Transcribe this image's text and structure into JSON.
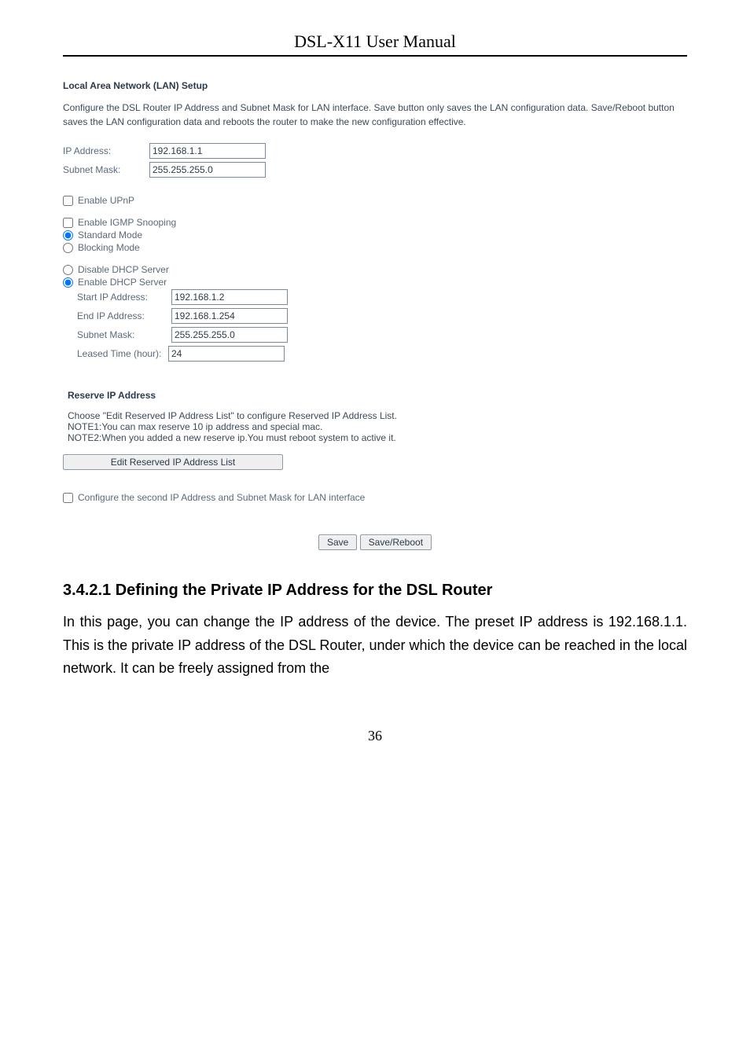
{
  "doc": {
    "header_title": "DSL-X11 User Manual",
    "page_number": "36"
  },
  "setup": {
    "title": "Local Area Network (LAN) Setup",
    "description": "Configure the DSL Router IP Address and Subnet Mask for LAN interface.  Save button only saves the LAN configuration data. Save/Reboot button saves the LAN configuration data and reboots the router to make the new configuration effective.",
    "ip_label": "IP Address:",
    "ip_value": "192.168.1.1",
    "mask_label": "Subnet Mask:",
    "mask_value": "255.255.255.0",
    "upnp_label": "Enable UPnP",
    "igmp_label": "Enable IGMP Snooping",
    "standard_label": "Standard Mode",
    "blocking_label": "Blocking Mode",
    "disable_dhcp_label": "Disable DHCP Server",
    "enable_dhcp_label": "Enable DHCP Server",
    "start_ip_label": "Start IP Address:",
    "start_ip_value": "192.168.1.2",
    "end_ip_label": "End IP Address:",
    "end_ip_value": "192.168.1.254",
    "dhcp_mask_label": "Subnet Mask:",
    "dhcp_mask_value": "255.255.255.0",
    "leased_label": "Leased Time (hour):",
    "leased_value": "24"
  },
  "reserve": {
    "title": "Reserve IP Address",
    "line1": "Choose \"Edit Reserved IP Address List\" to configure Reserved IP Address List.",
    "line2": "NOTE1:You can max reserve 10 ip address and special mac.",
    "line3": "NOTE2:When you added a new reserve ip.You must reboot system to active it.",
    "edit_btn": "Edit Reserved IP Address List"
  },
  "second_ip": {
    "label": "Configure the second IP Address and Subnet Mask for LAN interface"
  },
  "buttons": {
    "save": "Save",
    "save_reboot": "Save/Reboot"
  },
  "section": {
    "heading": "3.4.2.1  Defining the Private IP Address for the DSL Router",
    "paragraph": "In this page, you can change the IP address of the device. The preset IP address is 192.168.1.1. This is the private IP address of the DSL Router, under which the device can be reached in the local network. It can be freely assigned from the"
  }
}
